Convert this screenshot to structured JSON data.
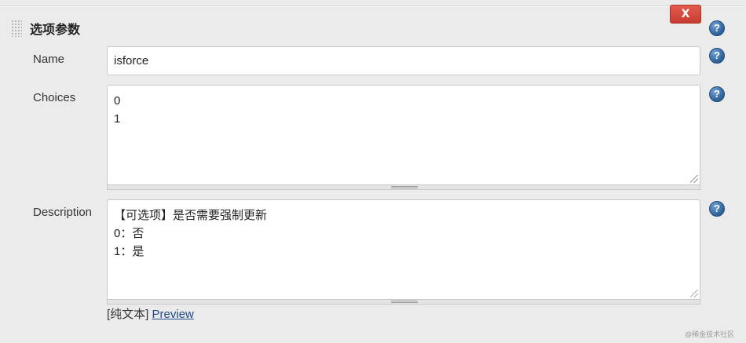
{
  "section": {
    "title": "选项参数",
    "delete_label": "X",
    "help_glyph": "?"
  },
  "name_field": {
    "label": "Name",
    "value": "isforce"
  },
  "choices_field": {
    "label": "Choices",
    "lines": [
      "0",
      "1"
    ]
  },
  "description_field": {
    "label": "Description",
    "lines": [
      "【可选项】是否需要强制更新",
      "0：否",
      "1：是"
    ],
    "format_label": "[纯文本]",
    "preview_label": "Preview"
  },
  "watermark": "@稀金技术社区",
  "colors": {
    "background": "#ebebeb",
    "delete_red": "#d9483d",
    "help_blue": "#2c5f95",
    "link_blue": "#204a87"
  },
  "icons": {
    "help": "question-circle-icon",
    "handle": "drag-handle-icon"
  }
}
